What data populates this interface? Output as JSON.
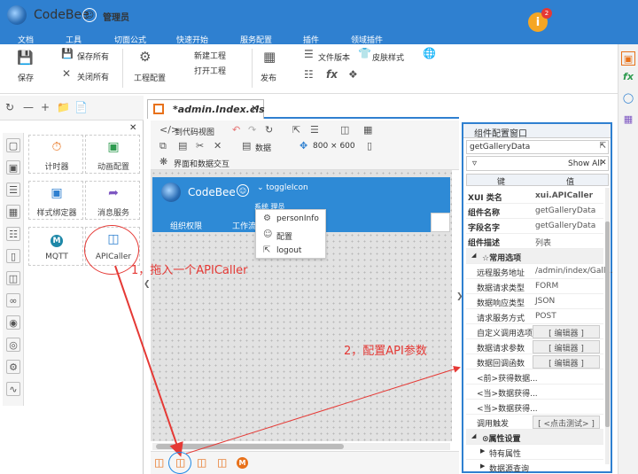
{
  "app": {
    "name": "CodeBee",
    "user": "管理员",
    "alert_count": "2",
    "alert_icon": "info-icon"
  },
  "menu": [
    "文档",
    "工具",
    "切面公式",
    "快速开始",
    "服务配置",
    "插件",
    "领域插件"
  ],
  "ribbon": {
    "save": "保存",
    "save_all": "保存所有",
    "close_all": "关闭所有",
    "project_config": "工程配置",
    "new_project": "新建工程",
    "open_project": "打开工程",
    "publish": "发布",
    "file_version": "文件版本",
    "skin_style": "皮肤样式"
  },
  "editor": {
    "tab_label": "*admin.Index.cls",
    "to_code_view": "到代码视图",
    "data": "数据",
    "resolution": "800 × 600",
    "ui_data_interaction": "界面和数据交互"
  },
  "components": [
    {
      "label": "计时器",
      "icon": "timer-icon"
    },
    {
      "label": "动画配置",
      "icon": "animation-icon"
    },
    {
      "label": "样式绑定器",
      "icon": "style-binder-icon"
    },
    {
      "label": "消息服务",
      "icon": "message-service-icon"
    },
    {
      "label": "MQTT",
      "icon": "mqtt-icon"
    },
    {
      "label": "APICaller",
      "icon": "apicaller-icon"
    }
  ],
  "preview": {
    "app_name": "CodeBee",
    "toggle": "toggleIcon",
    "menu1": "组织权限",
    "menu2": "工作流",
    "sys_text": "系统  理员",
    "dropdown": [
      {
        "label": "personInfo",
        "icon": "gear-icon"
      },
      {
        "label": "配置",
        "icon": "smile-icon"
      },
      {
        "label": "logout",
        "icon": "logout-icon"
      }
    ]
  },
  "props": {
    "title": "组件配置窗口",
    "selected": "getGalleryData",
    "show_all": "Show All",
    "col_key": "键",
    "col_value": "值",
    "rows": [
      {
        "key": "XUI 类名",
        "value": "xui.APICaller",
        "bold": true
      },
      {
        "key": "组件名称",
        "value": "getGalleryData",
        "bold": true
      },
      {
        "key": "字段名字",
        "value": "getGalleryData",
        "bold": true
      },
      {
        "key": "组件描述",
        "value": "列表",
        "bold": true
      },
      {
        "key": "☆常用选项",
        "value": "",
        "section": true
      },
      {
        "key": "远程服务地址",
        "value": "/admin/index/Gall..."
      },
      {
        "key": "数据请求类型",
        "value": "FORM"
      },
      {
        "key": "数据响应类型",
        "value": "JSON"
      },
      {
        "key": "请求服务方式",
        "value": "POST"
      },
      {
        "key": "自定义调用选项",
        "button": "[ 编辑器 ]"
      },
      {
        "key": "数据请求参数",
        "button": "[ 编辑器 ]"
      },
      {
        "key": "数据回调函数",
        "button": "[ 编辑器 ]"
      },
      {
        "key": "<前>获得数据...",
        "value": ""
      },
      {
        "key": "<当>数据获得...",
        "value": ""
      },
      {
        "key": "<当>数据获得...",
        "value": ""
      },
      {
        "key": "调用触发",
        "button": "[ <点击测试> ]"
      },
      {
        "key": "⊙属性设置",
        "value": "",
        "section": true
      },
      {
        "key": "特有属性",
        "value": "",
        "sub": true
      },
      {
        "key": "数据源查询",
        "value": "",
        "sub": true
      }
    ]
  },
  "annotations": {
    "step1": "1，拖入一个APICaller",
    "step2": "2，配置API参数"
  },
  "colors": {
    "brand": "#2f80d0",
    "accent": "#e8711a",
    "annotation": "#e53935",
    "highlight": "#1e88e5"
  }
}
